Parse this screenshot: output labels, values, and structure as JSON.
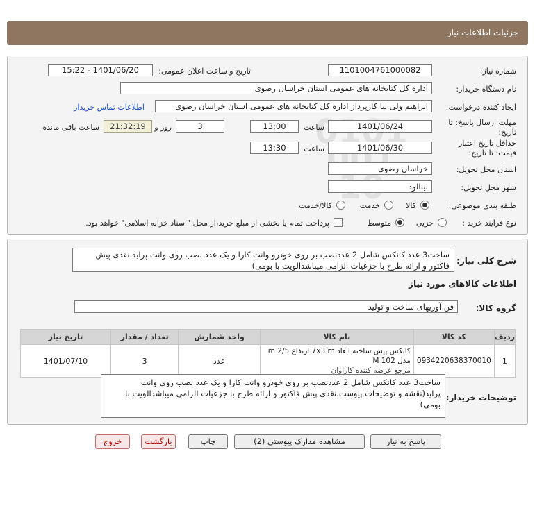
{
  "header": {
    "title": "جزئیات اطلاعات نیاز"
  },
  "form": {
    "need_number_label": "شماره نیاز:",
    "need_number": "1101004761000082",
    "announce_label": "تاریخ و ساعت اعلان عمومی:",
    "announce_value": "1401/06/20 - 15:22",
    "buyer_org_label": "نام دستگاه خریدار:",
    "buyer_org": "اداره کل کتابخانه های عمومی استان خراسان رضوی",
    "creator_label": "ایجاد کننده درخواست:",
    "creator": "ابراهیم ولی نیا کارپرداز اداره کل کتابخانه های عمومی استان خراسان رضوی",
    "contact_link": "اطلاعات تماس خریدار",
    "deadline_label_1": "مهلت ارسال پاسخ: تا",
    "deadline_label_2": "تاریخ:",
    "deadline_date": "1401/06/24",
    "time_word": "ساعت",
    "deadline_time": "13:00",
    "days_value": "3",
    "days_word": "روز و",
    "remaining_time": "21:32:19",
    "remaining_label": "ساعت باقی مانده",
    "validity_label_1": "حداقل تاریخ اعتبار",
    "validity_label_2": "قیمت: تا تاریخ:",
    "validity_date": "1401/06/30",
    "validity_time": "13:30",
    "province_label": "استان محل تحویل:",
    "province": "خراسان رضوی",
    "city_label": "شهر محل تحویل:",
    "city": "بینالود",
    "category_label": "طبقه بندی موضوعی:",
    "category_options": [
      "کالا",
      "خدمت",
      "کالا/خدمت"
    ],
    "process_label": "نوع فرآیند خرید :",
    "process_options": [
      "جزیی",
      "متوسط"
    ],
    "payment_note": "پرداخت تمام یا بخشی از مبلغ خرید،از محل \"اسناد خزانه اسلامی\" خواهد بود."
  },
  "description": {
    "label": "شرح کلی نیاز:",
    "text": "ساخت3 عدد کانکس شامل 2 عددنصب بر روی خودرو وانت کارا و یک عدد نصب روی وانت پراید.نقدی پیش فاکتور و ارائه طرح با جزعیات الزامی میباشدالویت با بومی)"
  },
  "goods": {
    "section_title": "اطلاعات کالاهای مورد نیاز",
    "group_label": "گروه کالا:",
    "group_value": "فن آوریهای ساخت و تولید",
    "columns": [
      "ردیف",
      "کد کالا",
      "نام کالا",
      "واحد شمارش",
      "تعداد / مقدار",
      "تاریخ نیاز"
    ],
    "rows": [
      {
        "index": "1",
        "code": "0934220638370010",
        "name_line1": "کانکس پیش ساخته ابعاد 7x3 m ارتفاع 2/5 m مدل M 102",
        "name_line2": "مرجع عرضه کننده کاراوان",
        "unit": "عدد",
        "qty": "3",
        "date": "1401/07/10"
      }
    ]
  },
  "buyer_notes": {
    "label": "توضیحات خریدار:",
    "text": "ساخت3 عدد کانکس شامل 2 عددنصب بر روی خودرو وانت کارا و یک عدد نصب روی وانت پراید(نقشه و توضیحات پیوست.نقدی پیش فاکتور و ارائه طرح با جزعیات الزامی میباشدالویت با بومی)"
  },
  "buttons": {
    "reply": "پاسخ به نیاز",
    "attachments": "مشاهده مدارک پیوستی (2)",
    "print": "چاپ",
    "back": "بازگشت",
    "exit": "خروج"
  },
  "watermark": {
    "brand": "ParsNamadData",
    "line1": "پایگاه اطلاع رسانی مناقصه و مزایده",
    "line2": "ارگان ارائه هی پارس نماد داده ها",
    "phone": "۰۲۱-۸۸۳۴۹۶۷۰",
    "digits": "0101 001 10"
  },
  "colors": {
    "header": "#8e7660",
    "link": "#1a4fc8",
    "remaining_bg": "#f3f0d8"
  }
}
